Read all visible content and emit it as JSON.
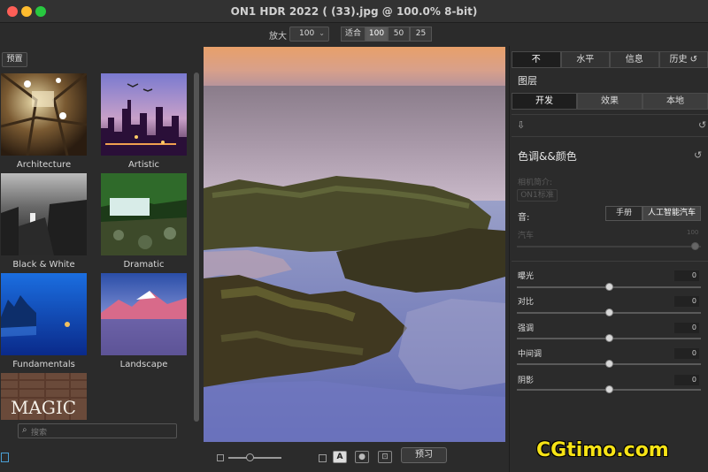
{
  "window": {
    "title": "ON1 HDR 2022 ( (33).jpg @ 100.0% 8-bit)"
  },
  "toolbar": {
    "zoom_label": "放大",
    "zoom_value": "100",
    "fit_label": "适合",
    "fit_options": [
      "100",
      "50",
      "25"
    ],
    "fit_selected": "100"
  },
  "presets": {
    "button_label": "预置",
    "items": [
      {
        "label": "Architecture"
      },
      {
        "label": "Artistic"
      },
      {
        "label": "Black & White"
      },
      {
        "label": "Dramatic"
      },
      {
        "label": "Fundamentals"
      },
      {
        "label": "Landscape"
      },
      {
        "label": "",
        "thumb_text": "MAGIC"
      }
    ],
    "search_placeholder": "搜索"
  },
  "canvas_bar": {
    "preview_label": "预习",
    "text_overlay_label": "A"
  },
  "right_panel": {
    "tabs": [
      "不",
      "水平",
      "信息",
      "历史"
    ],
    "tab_selected": "不",
    "layers_title": "图层",
    "develop_tabs": [
      "开发",
      "效果",
      "本地"
    ],
    "develop_selected": "开发",
    "section_title": "色调&&颜色",
    "camera_profile_label": "相机简介:",
    "camera_profile_value": "ON1标准",
    "tone_label": "音:",
    "tone_modes": [
      "手册",
      "人工智能汽车"
    ],
    "tone_selected": "人工智能汽车",
    "auto_label": "汽车",
    "auto_value": "100",
    "sliders": [
      {
        "label": "曝光",
        "value": "0"
      },
      {
        "label": "对比",
        "value": "0"
      },
      {
        "label": "强调",
        "value": "0"
      },
      {
        "label": "中间调",
        "value": "0"
      },
      {
        "label": "阴影",
        "value": "0"
      }
    ]
  },
  "watermark": "CGtimo.com",
  "colors": {
    "background": "#2b2b2b",
    "selected_tab": "#1e1e1e",
    "watermark": "#f6e316",
    "focus_outline": "#4a9fd4"
  }
}
